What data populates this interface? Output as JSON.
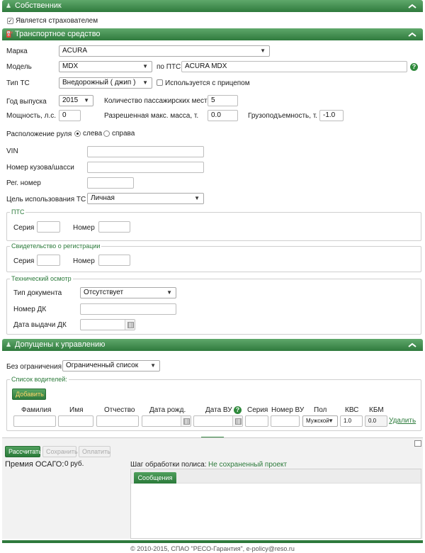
{
  "owner": {
    "header": "Собственник",
    "is_insurer_label": "Является страхователем",
    "is_insurer_checked": true
  },
  "vehicle": {
    "header": "Транспортное средство",
    "brand_label": "Марка",
    "brand_value": "ACURA",
    "model_label": "Модель",
    "model_value": "MDX",
    "pts_label": "по ПТС",
    "pts_value": "ACURA MDX",
    "type_label": "Тип ТС",
    "type_value": "Внедорожный ( джип )",
    "trailer_label": "Используется с прицепом",
    "year_label": "Год выпуска",
    "year_value": "2015",
    "seats_label": "Количество пассажирских мест",
    "seats_value": "5",
    "power_label": "Мощность, л.с.",
    "power_value": "0",
    "max_mass_label": "Разрешенная макс. масса, т.",
    "max_mass_value": "0.0",
    "capacity_label": "Грузоподъемность, т.",
    "capacity_value": "-1.0",
    "steering_label": "Расположение руля",
    "steering_left": "слева",
    "steering_right": "справа",
    "vin_label": "VIN",
    "body_label": "Номер кузова/шасси",
    "reg_label": "Рег. номер",
    "purpose_label": "Цель использования ТС",
    "purpose_value": "Личная",
    "pts_group": {
      "title": "ПТС",
      "series_label": "Серия",
      "number_label": "Номер"
    },
    "reg_cert_group": {
      "title": "Свидетельство о регистрации",
      "series_label": "Серия",
      "number_label": "Номер"
    },
    "inspection_group": {
      "title": "Технический осмотр",
      "doc_type_label": "Тип документа",
      "doc_type_value": "Отсутствует",
      "dk_number_label": "Номер ДК",
      "dk_date_label": "Дата выдачи ДК"
    }
  },
  "drivers": {
    "header": "Допущены к управлению",
    "restriction_label": "Без ограничения",
    "restriction_value": "Ограниченный список",
    "list_title": "Список водителей:",
    "add_button": "Добавить",
    "columns": {
      "surname": "Фамилия",
      "name": "Имя",
      "patronymic": "Отчество",
      "birth_date": "Дата рожд.",
      "license_date": "Дата ВУ",
      "series": "Серия",
      "license_number": "Номер ВУ",
      "gender": "Пол",
      "kvs": "КВС",
      "kbm": "КБМ"
    },
    "row": {
      "gender_value": "Мужской",
      "kvs_value": "1.0",
      "kbm_value": "0.0",
      "delete_link": "Удалить"
    }
  },
  "bottom": {
    "calculate_button": "Рассчитать",
    "save_button": "Сохранить",
    "pay_button": "Оплатить",
    "premium_label": "Премия ОСАГО:",
    "premium_value": "0 руб.",
    "step_label": "Шаг обработки полиса:",
    "step_value": "Не сохраненный проект",
    "messages_tab": "Сообщения"
  },
  "footer": {
    "copyright": "© 2010-2015, СПАО \"РЕСО-Гарантия\", e-policy@reso.ru"
  },
  "colors": {
    "brand_green": "#2f7a3d",
    "label_green": "#2b7a3a",
    "help_green": "#2f8a3c"
  }
}
